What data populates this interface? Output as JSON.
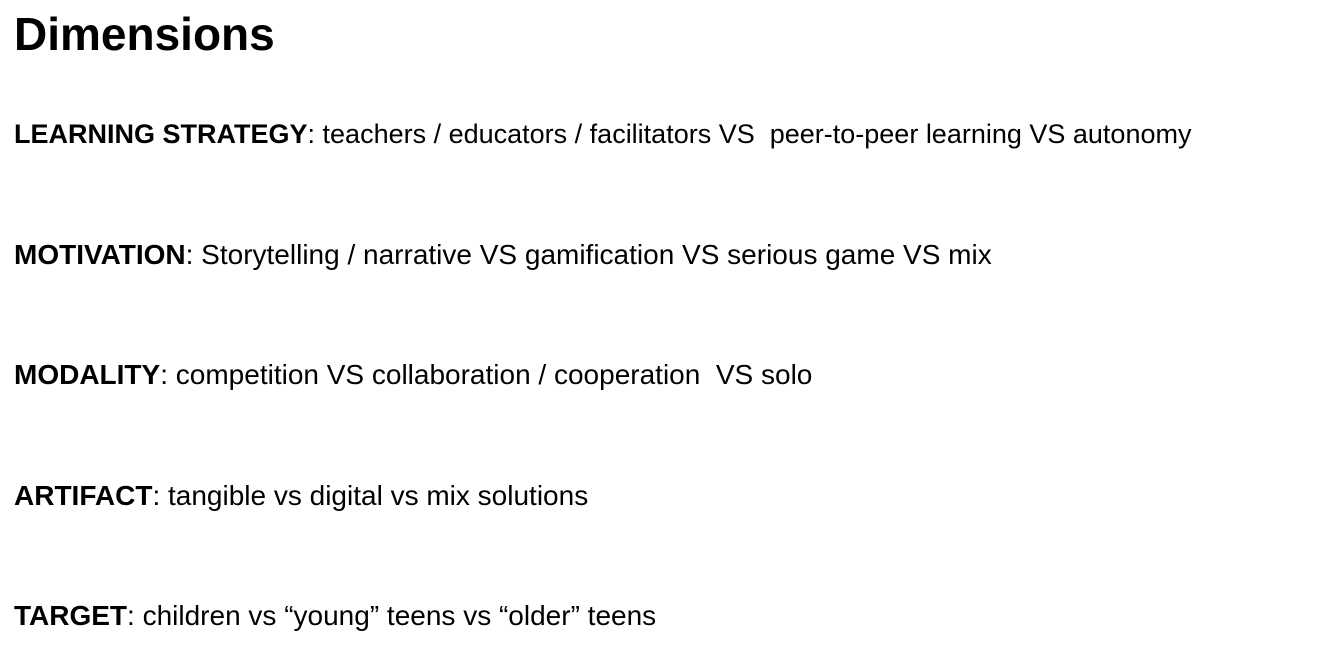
{
  "title": "Dimensions",
  "dimensions": [
    {
      "label": "LEARNING STRATEGY",
      "separator": ": ",
      "text": "teachers / educators / facilitators VS  peer-to-peer learning VS autonomy"
    },
    {
      "label": "MOTIVATION",
      "separator": ": ",
      "text": "Storytelling / narrative VS gamification VS serious game VS mix"
    },
    {
      "label": "MODALITY",
      "separator": ": ",
      "text": "competition VS collaboration / cooperation  VS solo"
    },
    {
      "label": "ARTIFACT",
      "separator": ": ",
      "text": "tangible vs digital vs mix solutions"
    },
    {
      "label": "TARGET",
      "separator": ": ",
      "text": "children vs “young” teens vs “older” teens"
    }
  ]
}
